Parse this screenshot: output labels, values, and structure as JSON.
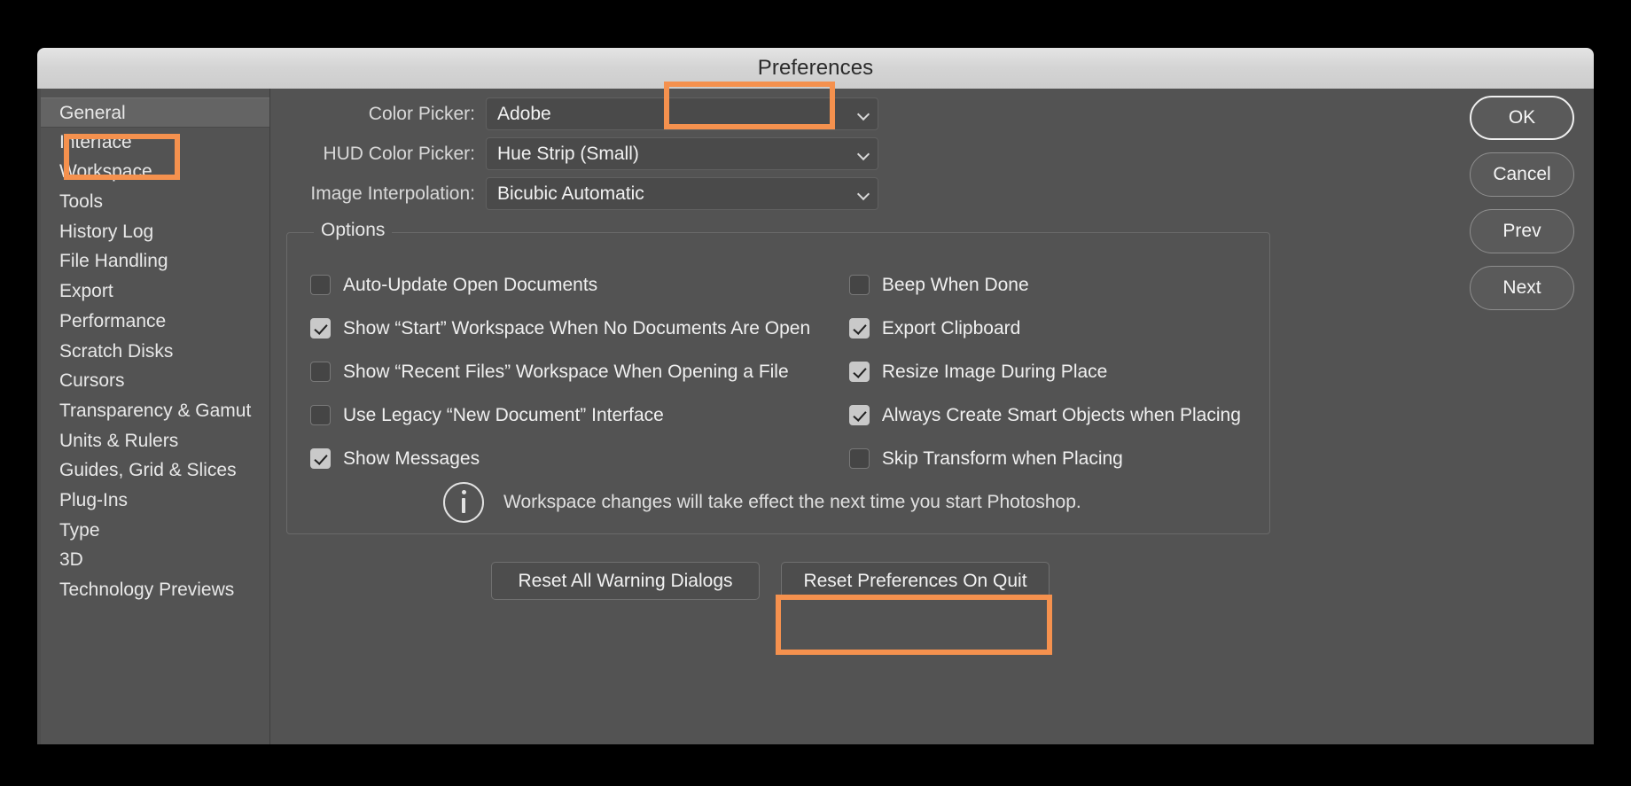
{
  "window": {
    "title": "Preferences"
  },
  "sidebar": {
    "items": [
      {
        "label": "General",
        "selected": true
      },
      {
        "label": "Interface",
        "selected": false
      },
      {
        "label": "Workspace",
        "selected": false
      },
      {
        "label": "Tools",
        "selected": false
      },
      {
        "label": "History Log",
        "selected": false
      },
      {
        "label": "File Handling",
        "selected": false
      },
      {
        "label": "Export",
        "selected": false
      },
      {
        "label": "Performance",
        "selected": false
      },
      {
        "label": "Scratch Disks",
        "selected": false
      },
      {
        "label": "Cursors",
        "selected": false
      },
      {
        "label": "Transparency & Gamut",
        "selected": false
      },
      {
        "label": "Units & Rulers",
        "selected": false
      },
      {
        "label": "Guides, Grid & Slices",
        "selected": false
      },
      {
        "label": "Plug-Ins",
        "selected": false
      },
      {
        "label": "Type",
        "selected": false
      },
      {
        "label": "3D",
        "selected": false
      },
      {
        "label": "Technology Previews",
        "selected": false
      }
    ]
  },
  "fields": [
    {
      "label": "Color Picker:",
      "value": "Adobe"
    },
    {
      "label": "HUD Color Picker:",
      "value": "Hue Strip (Small)"
    },
    {
      "label": "Image Interpolation:",
      "value": "Bicubic Automatic"
    }
  ],
  "options": {
    "legend": "Options",
    "left": [
      {
        "label": "Auto-Update Open Documents",
        "checked": false
      },
      {
        "label": "Show “Start” Workspace When No Documents Are Open",
        "checked": true
      },
      {
        "label": "Show “Recent Files” Workspace When Opening a File",
        "checked": false
      },
      {
        "label": "Use Legacy “New Document” Interface",
        "checked": false
      },
      {
        "label": "Show Messages",
        "checked": true
      }
    ],
    "right": [
      {
        "label": "Beep When Done",
        "checked": false
      },
      {
        "label": "Export Clipboard",
        "checked": true
      },
      {
        "label": "Resize Image During Place",
        "checked": true
      },
      {
        "label": "Always Create Smart Objects when Placing",
        "checked": true
      },
      {
        "label": "Skip Transform when Placing",
        "checked": false
      }
    ],
    "note": "Workspace changes will take effect the next time you start Photoshop."
  },
  "bottom_buttons": [
    {
      "label": "Reset All Warning Dialogs"
    },
    {
      "label": "Reset Preferences On Quit"
    }
  ],
  "right_rail_buttons": [
    {
      "label": "OK",
      "primary": true
    },
    {
      "label": "Cancel",
      "primary": false
    },
    {
      "label": "Prev",
      "primary": false
    },
    {
      "label": "Next",
      "primary": false
    }
  ],
  "annotation": {
    "color": "#f5914e",
    "targets": [
      "Preferences",
      "General",
      "Reset Preferences On Quit"
    ]
  }
}
